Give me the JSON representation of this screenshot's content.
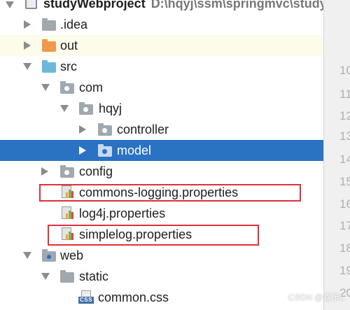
{
  "project": {
    "name": "studyWebproject",
    "path": "D:\\hqyj\\ssm\\springmvc\\study"
  },
  "tree": [
    {
      "label": "studyWebproject"
    },
    {
      "label": ".idea"
    },
    {
      "label": "out"
    },
    {
      "label": "src"
    },
    {
      "label": "com"
    },
    {
      "label": "hqyj"
    },
    {
      "label": "controller"
    },
    {
      "label": "model"
    },
    {
      "label": "config"
    },
    {
      "label": "commons-logging.properties"
    },
    {
      "label": "log4j.properties"
    },
    {
      "label": "simplelog.properties"
    },
    {
      "label": "web"
    },
    {
      "label": "static"
    },
    {
      "label": "common.css"
    }
  ],
  "css_badge": "CSS",
  "gutter_numbers": [
    "10",
    "11",
    "12",
    "13",
    "14",
    "15",
    "16",
    "17",
    "18",
    "19",
    "20"
  ],
  "watermark": "CSDN @喜乐L",
  "colors": {
    "selection": "#2a72c2",
    "highlight_row": "#fdfbe9",
    "annotation_box": "#e0303a"
  }
}
